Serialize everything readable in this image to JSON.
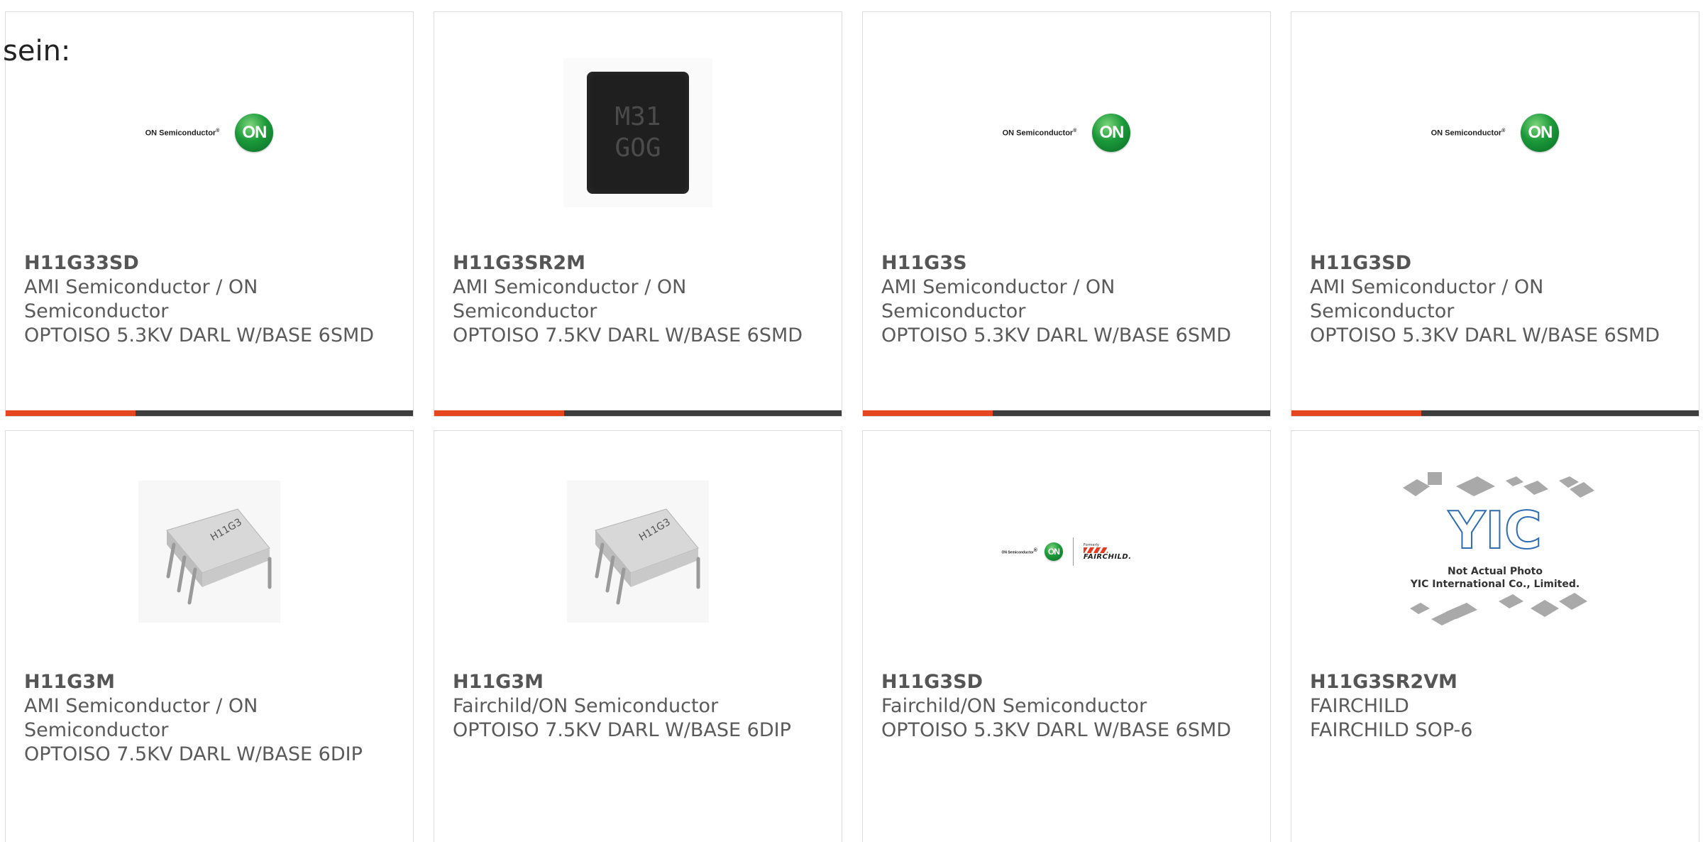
{
  "intro_text": "sein:",
  "colors": {
    "accent_bar": "#e5461f",
    "bar_dark": "#3d3d3d",
    "on_green": "#1b9a3a"
  },
  "products": [
    {
      "part": "H11G33SD",
      "manufacturer": "AMI Semiconductor / ON Semiconductor",
      "description": "OPTOISO 5.3KV DARL W/BASE 6SMD",
      "image": "on-semiconductor-logo"
    },
    {
      "part": "H11G3SR2M",
      "manufacturer": "AMI Semiconductor / ON Semiconductor",
      "description": "OPTOISO 7.5KV DARL W/BASE 6SMD",
      "image": "chip-photo",
      "chip_marking": [
        "M31",
        "GOG"
      ]
    },
    {
      "part": "H11G3S",
      "manufacturer": "AMI Semiconductor / ON Semiconductor",
      "description": "OPTOISO 5.3KV DARL W/BASE 6SMD",
      "image": "on-semiconductor-logo"
    },
    {
      "part": "H11G3SD",
      "manufacturer": "AMI Semiconductor / ON Semiconductor",
      "description": "OPTOISO 5.3KV DARL W/BASE 6SMD",
      "image": "on-semiconductor-logo"
    },
    {
      "part": "H11G3M",
      "manufacturer": "AMI Semiconductor / ON Semiconductor",
      "description": "OPTOISO 7.5KV DARL W/BASE 6DIP",
      "image": "dip-chip-photo"
    },
    {
      "part": "H11G3M",
      "manufacturer": "Fairchild/ON Semiconductor",
      "description": "OPTOISO 7.5KV DARL W/BASE 6DIP",
      "image": "dip-chip-photo"
    },
    {
      "part": "H11G3SD",
      "manufacturer": "Fairchild/ON Semiconductor",
      "description": "OPTOISO 5.3KV DARL W/BASE 6SMD",
      "image": "on-fairchild-logo"
    },
    {
      "part": "H11G3SR2VM",
      "manufacturer": "FAIRCHILD",
      "description": "FAIRCHILD SOP-6",
      "image": "yic-placeholder",
      "placeholder_line1": "Not Actual Photo",
      "placeholder_line2": "YIC International Co., Limited."
    }
  ],
  "logo": {
    "on_text": "ON Semiconductor",
    "on_badge": "ON",
    "formerly": "Formerly",
    "fairchild": "FAIRCHILD."
  }
}
